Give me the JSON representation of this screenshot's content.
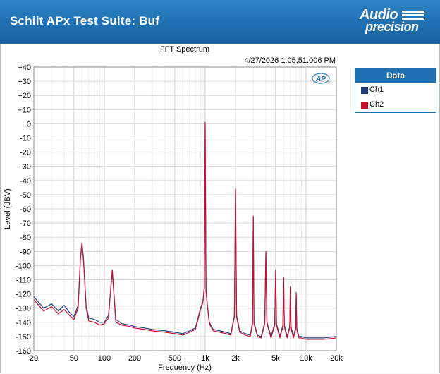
{
  "header": {
    "title": "Schiit APx Test Suite: Buf",
    "logo_line1": "Audio",
    "logo_line2": "precision"
  },
  "chart_data": {
    "type": "line",
    "title": "FFT Spectrum",
    "timestamp": "4/27/2026 1:05:51.006 PM",
    "xlabel": "Frequency (Hz)",
    "ylabel": "Level (dBV)",
    "x_scale": "log",
    "xlim": [
      20,
      20000
    ],
    "ylim": [
      -160,
      40
    ],
    "x_ticks": [
      20,
      50,
      100,
      200,
      500,
      1000,
      2000,
      5000,
      10000,
      20000
    ],
    "x_tick_labels": [
      "20",
      "50",
      "100",
      "200",
      "500",
      "1k",
      "2k",
      "5k",
      "10k",
      "20k"
    ],
    "y_ticks": [
      40,
      30,
      20,
      10,
      0,
      -10,
      -20,
      -30,
      -40,
      -50,
      -60,
      -70,
      -80,
      -90,
      -100,
      -110,
      -120,
      -130,
      -140,
      -150,
      -160
    ],
    "y_tick_labels": [
      "+40",
      "+30",
      "+20",
      "+10",
      "0",
      "-10",
      "-20",
      "-30",
      "-40",
      "-50",
      "-60",
      "-70",
      "-80",
      "-90",
      "-100",
      "-110",
      "-120",
      "-130",
      "-140",
      "-150",
      "-160"
    ],
    "grid": true,
    "legend_title": "Data",
    "legend_position": "right",
    "series": [
      {
        "name": "Ch1",
        "color": "#1f3f7f",
        "x": [
          20,
          25,
          30,
          35,
          40,
          45,
          50,
          55,
          58,
          60,
          62,
          66,
          70,
          80,
          90,
          100,
          110,
          118,
          120,
          122,
          130,
          150,
          180,
          200,
          250,
          300,
          400,
          500,
          600,
          700,
          800,
          900,
          950,
          980,
          1000,
          1020,
          1050,
          1100,
          1200,
          1400,
          1600,
          1800,
          1950,
          2000,
          2050,
          2200,
          2500,
          2800,
          2950,
          3000,
          3050,
          3300,
          3600,
          3900,
          4000,
          4100,
          4500,
          4900,
          5000,
          5100,
          5500,
          5900,
          6000,
          6100,
          6500,
          6900,
          7000,
          7100,
          7500,
          7900,
          8000,
          8100,
          8500,
          9000,
          10000,
          12000,
          15000,
          20000
        ],
        "y": [
          -122,
          -130,
          -127,
          -132,
          -128,
          -133,
          -136,
          -128,
          -95,
          -86,
          -95,
          -128,
          -137,
          -138,
          -140,
          -140,
          -135,
          -110,
          -105,
          -112,
          -138,
          -141,
          -142,
          -143,
          -144,
          -145,
          -146,
          -147,
          -148,
          -146,
          -144,
          -130,
          -125,
          -115,
          0,
          -118,
          -128,
          -140,
          -145,
          -146,
          -147,
          -148,
          -135,
          -47,
          -135,
          -146,
          -148,
          -149,
          -140,
          -66,
          -140,
          -149,
          -150,
          -140,
          -91,
          -140,
          -150,
          -141,
          -104,
          -141,
          -150,
          -142,
          -109,
          -142,
          -150,
          -143,
          -116,
          -143,
          -150,
          -144,
          -120,
          -144,
          -150,
          -150,
          -151,
          -151,
          -151,
          -150
        ]
      },
      {
        "name": "Ch2",
        "color": "#c8102e",
        "x": [
          20,
          25,
          30,
          35,
          40,
          45,
          50,
          55,
          58,
          60,
          62,
          66,
          70,
          80,
          90,
          100,
          110,
          118,
          120,
          122,
          130,
          150,
          180,
          200,
          250,
          300,
          400,
          500,
          600,
          700,
          800,
          900,
          950,
          980,
          1000,
          1020,
          1050,
          1100,
          1200,
          1400,
          1600,
          1800,
          1950,
          2000,
          2050,
          2200,
          2500,
          2800,
          2950,
          3000,
          3050,
          3300,
          3600,
          3900,
          4000,
          4100,
          4500,
          4900,
          5000,
          5100,
          5500,
          5900,
          6000,
          6100,
          6500,
          6900,
          7000,
          7100,
          7500,
          7900,
          8000,
          8100,
          8500,
          9000,
          10000,
          12000,
          15000,
          20000
        ],
        "y": [
          -124,
          -132,
          -129,
          -134,
          -131,
          -135,
          -138,
          -130,
          -94,
          -84,
          -94,
          -130,
          -139,
          -140,
          -142,
          -141,
          -137,
          -108,
          -103,
          -110,
          -140,
          -142,
          -143,
          -144,
          -145,
          -146,
          -147,
          -148,
          -149,
          -147,
          -145,
          -131,
          -126,
          -116,
          1,
          -117,
          -127,
          -141,
          -146,
          -147,
          -148,
          -149,
          -136,
          -46,
          -136,
          -147,
          -149,
          -150,
          -141,
          -65,
          -141,
          -150,
          -151,
          -141,
          -90,
          -141,
          -151,
          -142,
          -103,
          -142,
          -151,
          -143,
          -108,
          -143,
          -151,
          -144,
          -115,
          -144,
          -151,
          -145,
          -119,
          -145,
          -151,
          -151,
          -152,
          -152,
          -152,
          -151
        ]
      }
    ]
  }
}
